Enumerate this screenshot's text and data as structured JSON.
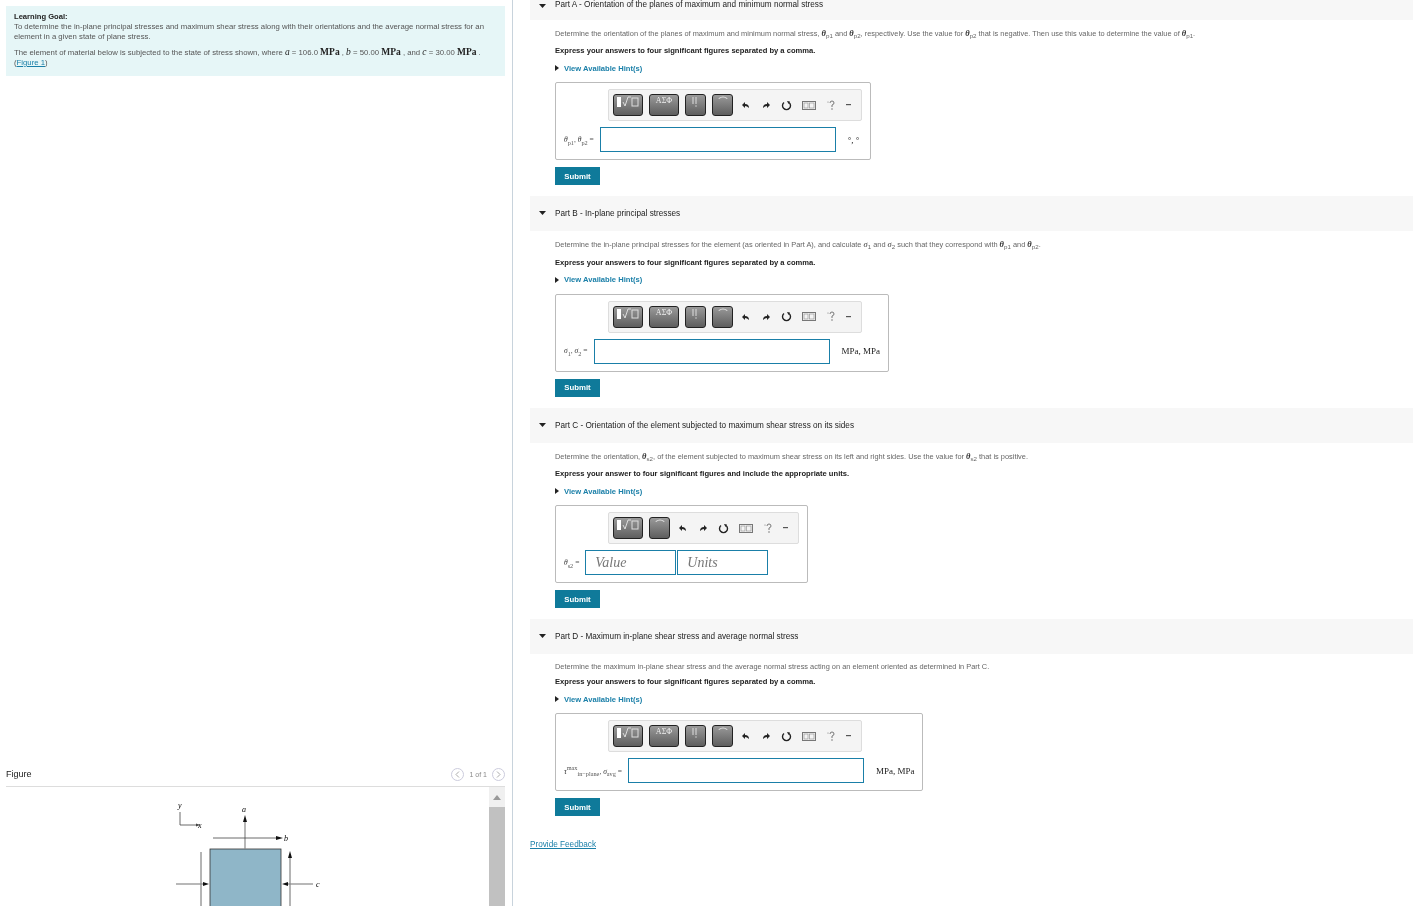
{
  "learning_goal": {
    "title": "Learning Goal:",
    "text": "To determine the in-plane principal stresses and maximum shear stress along with their orientations and the average normal stress for an element in a given state of plane stress.",
    "problem": "The element of material below is subjected to the state of stress shown, where *a* = 106.0 **MPa** , *b* = 50.00 **MPa** , and *c* = 30.00 **MPa** .(",
    "link": "Figure 1",
    "suffix": ")"
  },
  "figure": {
    "title": "Figure",
    "pager": "1 of 1",
    "labels": {
      "y": "y",
      "x": "x",
      "a": "a",
      "b": "b",
      "c": "c"
    }
  },
  "parts": [
    {
      "title": "Part A - Orientation of the planes of maximum and minimum normal stress",
      "expanded": true,
      "description": "Determine the orientation of the planes of maximum and minimum normal stress, **θ**$_{p1}$ and **θ**$_{p2}$, respectively. Use the value for **θ**$_{p2}$ that is negative. Then use this value to determine the value of **θ**$_{p1}$.",
      "instruction": "Express your answers to four significant figures separated by a comma.",
      "hint": "View Available Hint(s)",
      "tools": [
        {
          "kind": "templates"
        },
        {
          "kind": "symbols",
          "label": "ΑΣΦ"
        },
        {
          "kind": "vector"
        },
        {
          "kind": "units"
        },
        {
          "kind": "undo"
        },
        {
          "kind": "redo"
        },
        {
          "kind": "reset"
        },
        {
          "kind": "keyboard"
        },
        {
          "kind": "help"
        },
        {
          "kind": "more"
        }
      ],
      "answer": {
        "label": "*θ*$_{p1}$, *θ*$_{p2}$ =",
        "fields": [
          {
            "kind": "wide"
          }
        ],
        "units": "°, °"
      },
      "submit": "Submit"
    },
    {
      "title": "Part B - In-plane principal stresses",
      "expanded": true,
      "description": "Determine the in-plane principal stresses for the element (as oriented in Part A), and calculate *σ*$_{1}$ and *σ*$_{2}$ such that they correspond with **θ**$_{p1}$ and **θ**$_{p2}$.",
      "instruction": "Express your answers to four significant figures separated by a comma.",
      "hint": "View Available Hint(s)",
      "tools": [
        {
          "kind": "templates"
        },
        {
          "kind": "symbols",
          "label": "ΑΣΦ"
        },
        {
          "kind": "vector"
        },
        {
          "kind": "units"
        },
        {
          "kind": "undo"
        },
        {
          "kind": "redo"
        },
        {
          "kind": "reset"
        },
        {
          "kind": "keyboard"
        },
        {
          "kind": "help"
        },
        {
          "kind": "more"
        }
      ],
      "answer": {
        "label": "*σ*$_{1}$, *σ*$_{2}$ =",
        "fields": [
          {
            "kind": "wide"
          }
        ],
        "units": "MPa, MPa"
      },
      "submit": "Submit"
    },
    {
      "title": "Part C - Orientation of the element subjected to maximum shear stress on its sides",
      "expanded": true,
      "description": "Determine the orientation, **θ**$_{s2}$, of the element subjected to maximum shear stress on its left and right sides. Use the value for **θ**$_{s2}$ that is positive.",
      "instruction": "Express your answer to four significant figures and include the appropriate units.",
      "hint": "View Available Hint(s)",
      "tools": [
        {
          "kind": "templates"
        },
        {
          "kind": "units"
        },
        {
          "kind": "undo"
        },
        {
          "kind": "redo"
        },
        {
          "kind": "reset"
        },
        {
          "kind": "keyboard"
        },
        {
          "kind": "help"
        },
        {
          "kind": "more"
        }
      ],
      "answer": {
        "label": "*θ*$_{s2}$ =",
        "fields": [
          {
            "kind": "narrow",
            "placeholder": "Value"
          },
          {
            "kind": "narrow",
            "placeholder": "Units"
          }
        ]
      },
      "submit": "Submit"
    },
    {
      "title": "Part D - Maximum in-plane shear stress and average normal stress",
      "expanded": true,
      "description": "Determine the maximum in-plane shear stress and the average normal stress acting on an element oriented as determined in Part C.",
      "instruction": "Express your answers to four significant figures separated by a comma.",
      "hint": "View Available Hint(s)",
      "tools": [
        {
          "kind": "templates"
        },
        {
          "kind": "symbols",
          "label": "ΑΣΦ"
        },
        {
          "kind": "vector"
        },
        {
          "kind": "units"
        },
        {
          "kind": "undo"
        },
        {
          "kind": "redo"
        },
        {
          "kind": "reset"
        },
        {
          "kind": "keyboard"
        },
        {
          "kind": "help"
        },
        {
          "kind": "more"
        }
      ],
      "answer": {
        "label": "*τ*$^{max}$$_{in−plane}$, *σ*$_{avg}$ =",
        "fields": [
          {
            "kind": "wide"
          }
        ],
        "units": "MPa, MPa"
      },
      "submit": "Submit"
    }
  ],
  "feedback_link": "Provide Feedback"
}
